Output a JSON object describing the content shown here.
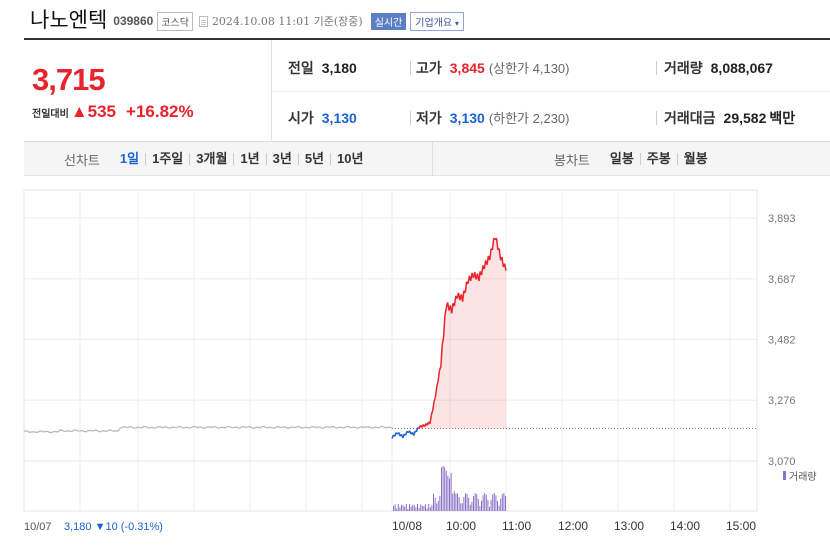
{
  "header": {
    "name": "나노엔텍",
    "code": "039860",
    "market": "코스닥",
    "datetime": "2024.10.08 11:01 기준(장중)",
    "realtime": "실시간",
    "company_info": "기업개요"
  },
  "quote": {
    "price": "3,715",
    "change_label": "전일대비",
    "change": "535",
    "change_pct": "+16.82%",
    "prev_close_label": "전일",
    "prev_close": "3,180",
    "open_label": "시가",
    "open": "3,130",
    "high_label": "고가",
    "high": "3,845",
    "upper_limit": "(상한가 4,130)",
    "low_label": "저가",
    "low": "3,130",
    "lower_limit": "(하한가 2,230)",
    "volume_label": "거래량",
    "volume": "8,088,067",
    "amount_label": "거래대금",
    "amount": "29,582",
    "amount_unit": "백만"
  },
  "periods": {
    "line_label": "선차트",
    "line_options": [
      "1일",
      "1주일",
      "3개월",
      "1년",
      "3년",
      "5년",
      "10년"
    ],
    "selected": "1일",
    "candle_label": "봉차트",
    "candle_options": [
      "일봉",
      "주봉",
      "월봉"
    ]
  },
  "colors": {
    "up": "#e8232b",
    "down": "#1b62d4",
    "volume_bar": "#8a72c8",
    "prev_day_line": "#bbbbbb",
    "accent": "#5b7ec5"
  },
  "chart_data": {
    "type": "line",
    "y_ticks": [
      "3,893",
      "3,687",
      "3,482",
      "3,276",
      "3,070"
    ],
    "ylim": [
      3070,
      3893
    ],
    "reference_line": 3180,
    "x_ticks": [
      "10/08",
      "10:00",
      "11:00",
      "12:00",
      "13:00",
      "14:00",
      "15:00"
    ],
    "volume_label": "거래량",
    "prev_day": {
      "date": "10/07",
      "close": "3,180",
      "change": "▼10",
      "change_pct": "(-0.31%)"
    },
    "series": [
      {
        "values_x": [
          "10/08 09:00",
          "09:05",
          "09:10",
          "09:15",
          "09:20",
          "09:25",
          "09:30",
          "09:40",
          "09:45",
          "09:50",
          "10:00",
          "10:10",
          "10:15",
          "10:20",
          "10:25",
          "10:30",
          "10:35",
          "10:40",
          "10:45",
          "10:50",
          "10:55",
          "11:01"
        ],
        "values": [
          3150,
          3165,
          3152,
          3170,
          3160,
          3185,
          3190,
          3200,
          3290,
          3400,
          3600,
          3580,
          3630,
          3620,
          3680,
          3700,
          3690,
          3730,
          3760,
          3830,
          3760,
          3715
        ]
      }
    ]
  }
}
